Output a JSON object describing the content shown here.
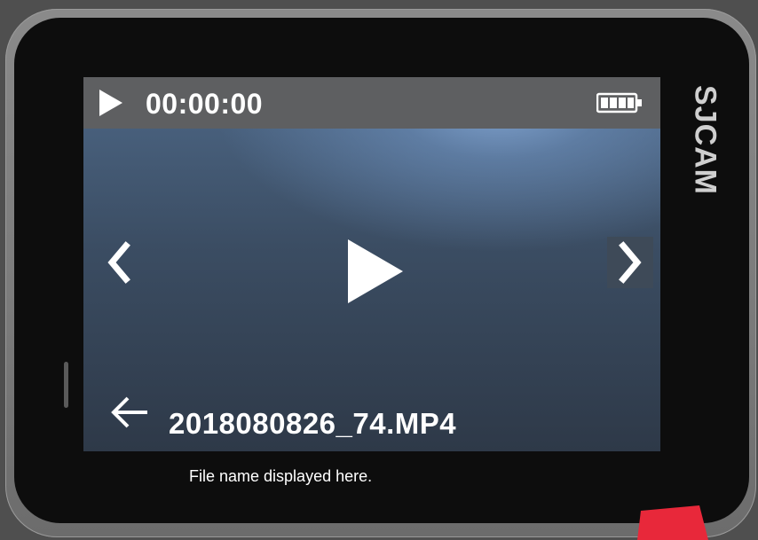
{
  "device": {
    "brand": "SJCAM"
  },
  "status_bar": {
    "timer": "00:00:00",
    "battery_icon": "battery-full-icon",
    "play_icon": "play-icon"
  },
  "navigation": {
    "prev_icon": "chevron-left-icon",
    "next_icon": "chevron-right-icon",
    "back_icon": "arrow-left-icon"
  },
  "player": {
    "play_icon": "play-icon",
    "file_name": "2018080826_74.MP4"
  },
  "caption": "File name displayed here.",
  "colors": {
    "screen_top": "#4d6786",
    "screen_bottom": "#2e3948",
    "status_bar": "#5e5f61",
    "device_body": "#0d0d0d",
    "bezel": "#7a7a7a",
    "annotation_arrow": "#e8283a"
  }
}
